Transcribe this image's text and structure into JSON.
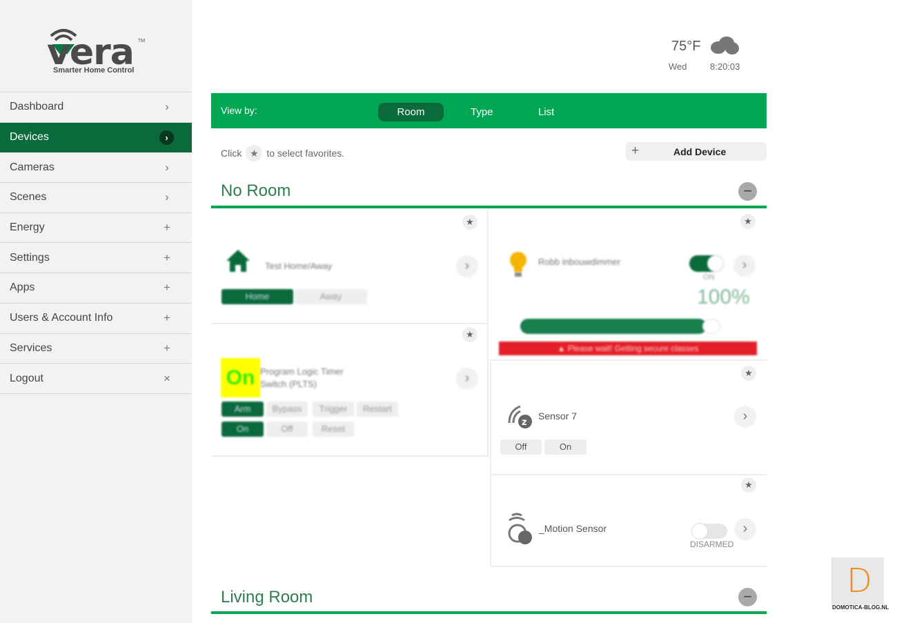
{
  "logo": {
    "word": "vera",
    "tm": "TM",
    "tagline": "Smarter Home Control"
  },
  "sidebar": {
    "items": [
      {
        "label": "Dashboard",
        "icon": "›"
      },
      {
        "label": "Devices",
        "icon": "›",
        "active": true
      },
      {
        "label": "Cameras",
        "icon": "›"
      },
      {
        "label": "Scenes",
        "icon": "›"
      },
      {
        "label": "Energy",
        "icon": "+"
      },
      {
        "label": "Settings",
        "icon": "+"
      },
      {
        "label": "Apps",
        "icon": "+"
      },
      {
        "label": "Users & Account Info",
        "icon": "+"
      },
      {
        "label": "Services",
        "icon": "+"
      },
      {
        "label": "Logout",
        "icon": "×"
      }
    ]
  },
  "weather": {
    "temp": "75°F",
    "day": "Wed",
    "time": "8:20:03",
    "icon": "cloud-icon"
  },
  "viewby": {
    "label": "View by:",
    "options": [
      "Room",
      "Type",
      "List"
    ],
    "selected": "Room"
  },
  "favorites": {
    "pre": "Click",
    "post": "to select favorites."
  },
  "add_device": {
    "icon": "+",
    "label": "Add Device"
  },
  "rooms": [
    {
      "name": "No Room"
    },
    {
      "name": "Living Room"
    }
  ],
  "devices": {
    "homeaway": {
      "name": "Test Home/Away",
      "buttons": [
        "Home",
        "Away"
      ]
    },
    "plts": {
      "badge": "On",
      "name1": "Program Logic Timer",
      "name2": "Switch (PLTS)",
      "row1": [
        "Arm",
        "Bypass",
        "Trigger",
        "Restart"
      ],
      "row2": [
        "On",
        "Off",
        "Reset"
      ]
    },
    "dimmer": {
      "name": "Robb inbouwdimmer",
      "state": "ON",
      "level": "100%",
      "level_value": 100,
      "warning": "Please wait! Getting secure classes"
    },
    "sensor7": {
      "name": "Sensor 7",
      "buttons": [
        "Off",
        "On"
      ]
    },
    "motion": {
      "name": "_Motion Sensor",
      "state": "DISARMED"
    }
  },
  "watermark": {
    "letter": "D",
    "text": "DOMOTICA-BLOG.NL"
  }
}
